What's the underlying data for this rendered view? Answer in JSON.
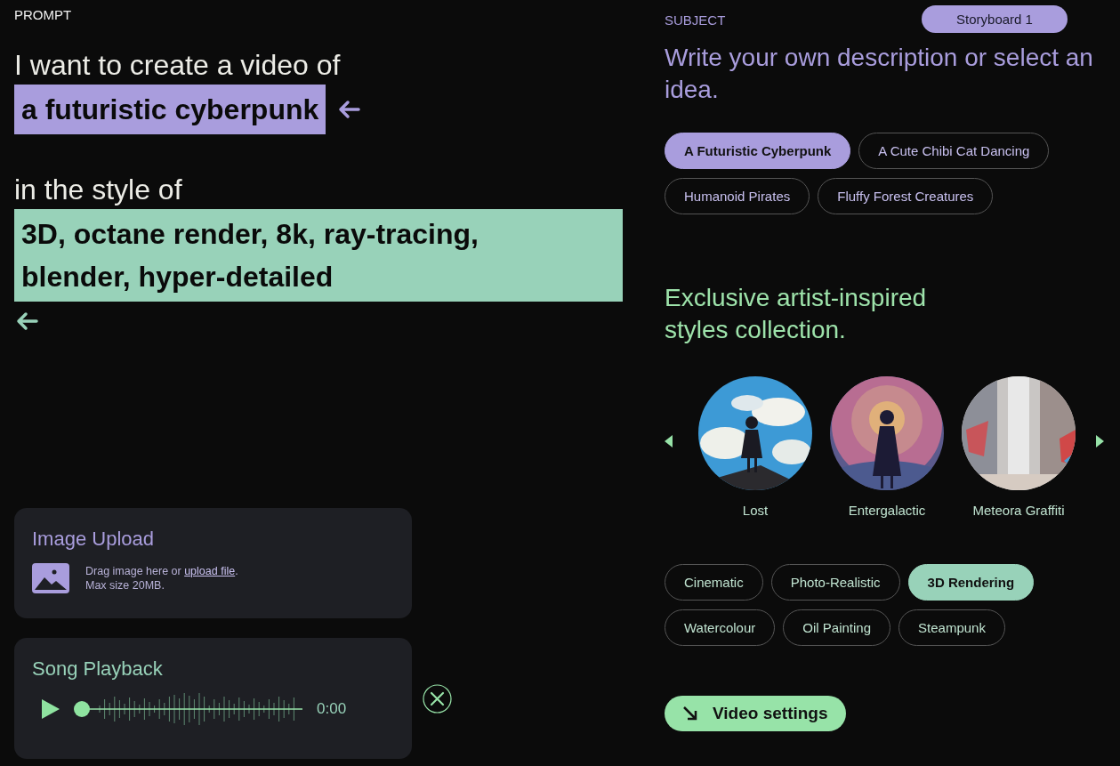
{
  "prompt": {
    "label": "PROMPT",
    "intro": "I want to create a video of",
    "subject": "a futuristic cyberpunk",
    "style_intro": "in the style of",
    "style": "3D, octane render, 8k, ray-tracing, blender, hyper-detailed"
  },
  "image_upload": {
    "title": "Image Upload",
    "text": "Drag image here or ",
    "link": "upload file",
    "after": ".",
    "size": "Max size 20MB."
  },
  "song_playback": {
    "title": "Song Playback",
    "level": 0,
    "time": "0:00"
  },
  "subject": {
    "label": "SUBJECT",
    "storyboard": "Storyboard 1",
    "heading": "Write your own description or select an idea.",
    "ideas": [
      {
        "label": "A Futuristic Cyberpunk",
        "selected": true
      },
      {
        "label": "A Cute Chibi Cat Dancing",
        "selected": false
      },
      {
        "label": "Humanoid Pirates",
        "selected": false
      },
      {
        "label": "Fluffy Forest Creatures",
        "selected": false
      }
    ]
  },
  "styles": {
    "heading": "Exclusive artist-inspired styles collection.",
    "collection": [
      {
        "name": "Lost",
        "kind": "picture"
      },
      {
        "name": "Entergalactic",
        "kind": "picture"
      },
      {
        "name": "Meteora Graffiti",
        "kind": "picture"
      }
    ],
    "chips": [
      {
        "label": "Cinematic",
        "selected": false
      },
      {
        "label": "Photo-Realistic",
        "selected": false
      },
      {
        "label": "3D Rendering",
        "selected": true
      },
      {
        "label": "Watercolour",
        "selected": false
      },
      {
        "label": "Oil Painting",
        "selected": false
      },
      {
        "label": "Steampunk",
        "selected": false
      }
    ],
    "video_settings": "Video settings"
  }
}
